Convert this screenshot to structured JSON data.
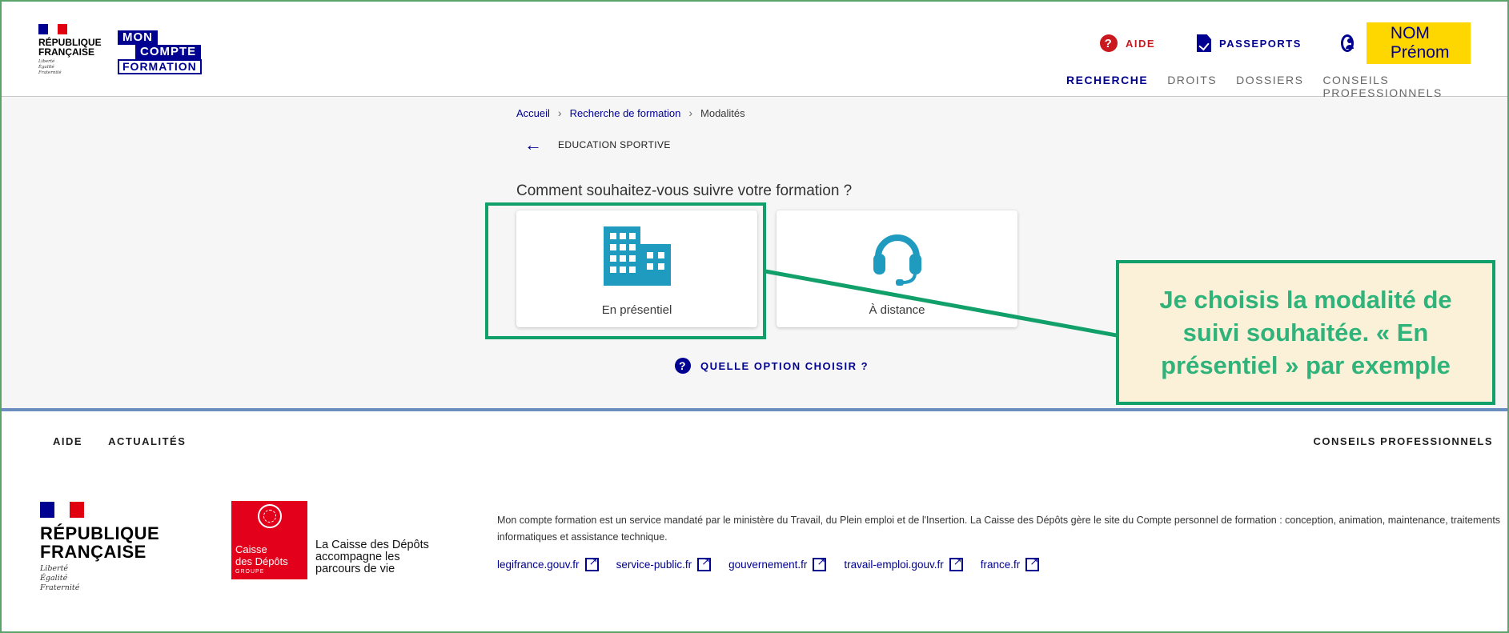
{
  "header": {
    "gov_logo": {
      "line1": "RÉPUBLIQUE",
      "line2": "FRANÇAISE",
      "motto": [
        "Liberté",
        "Égalité",
        "Fraternité"
      ]
    },
    "brand_logo": {
      "line1": "MON",
      "line2": "COMPTE",
      "line3": "FORMATION"
    },
    "top_links": {
      "aide": "AIDE",
      "passeports": "PASSEPORTS",
      "user_name": "NOM Prénom"
    },
    "nav": [
      {
        "label": "RECHERCHE",
        "active": true
      },
      {
        "label": "DROITS",
        "active": false
      },
      {
        "label": "DOSSIERS",
        "active": false
      },
      {
        "label": "CONSEILS PROFESSIONNELS",
        "active": false
      }
    ]
  },
  "main": {
    "breadcrumb": [
      "Accueil",
      "Recherche de formation",
      "Modalités"
    ],
    "back_label": "EDUCATION SPORTIVE",
    "question": "Comment souhaitez-vous suivre votre formation ?",
    "options": [
      {
        "label": "En présentiel",
        "icon": "building-icon",
        "selected": true
      },
      {
        "label": "À distance",
        "icon": "headset-icon",
        "selected": false
      }
    ],
    "help_link": "QUELLE OPTION CHOISIR ?"
  },
  "annotation": {
    "text": "Je choisis la modalité de suivi souhaitée. « En présentiel » par exemple",
    "color": "#12a06a"
  },
  "footer": {
    "nav_left": [
      "AIDE",
      "ACTUALITÉS"
    ],
    "nav_right": "CONSEILS PROFESSIONNELS",
    "gov_logo": {
      "line1": "RÉPUBLIQUE",
      "line2": "FRANÇAISE",
      "motto": [
        "Liberté",
        "Égalité",
        "Fraternité"
      ]
    },
    "cdc_logo": {
      "line1": "Caisse",
      "line2": "des Dépôts",
      "line3": "GROUPE"
    },
    "cdc_tagline": [
      "La Caisse des Dépôts",
      "accompagne les",
      "parcours de vie"
    ],
    "description": "Mon compte formation est un service mandaté par le ministère du Travail, du Plein emploi et de l'Insertion. La Caisse des Dépôts gère le site du Compte personnel de formation : conception, animation, maintenance, traitements informatiques et assistance technique.",
    "links": [
      "legifrance.gouv.fr",
      "service-public.fr",
      "gouvernement.fr",
      "travail-emploi.gouv.fr",
      "france.fr"
    ]
  },
  "colors": {
    "brand_blue": "#000091",
    "alert_red": "#c9191e",
    "icon_teal": "#1f9bbf",
    "highlight_yellow": "#ffd700",
    "callout_bg": "#fbf1d8",
    "callout_text": "#2fb37a"
  }
}
